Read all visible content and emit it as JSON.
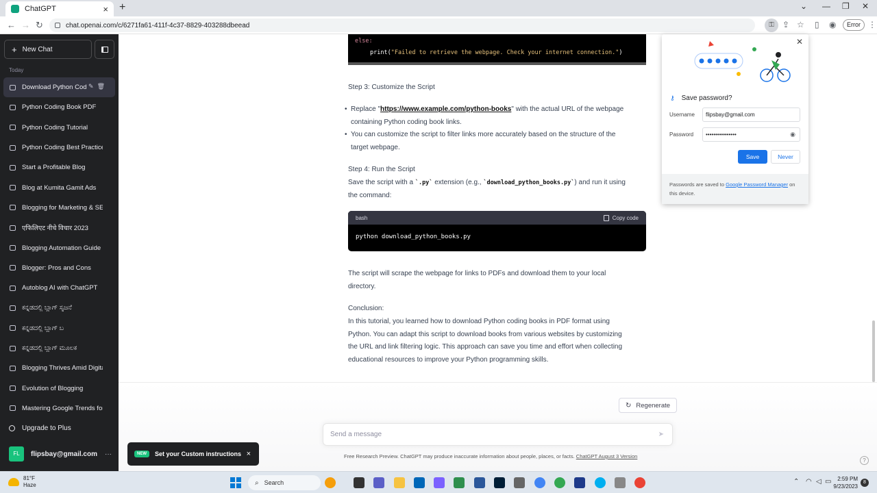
{
  "browser": {
    "tab_title": "ChatGPT",
    "url": "chat.openai.com/c/6271fa61-411f-4c37-8829-403288dbeead",
    "error_label": "Error"
  },
  "sidebar": {
    "new_chat": "New Chat",
    "section_today": "Today",
    "items": [
      {
        "label": "Download Python Cod"
      },
      {
        "label": "Python Coding Book PDF"
      },
      {
        "label": "Python Coding Tutorial"
      },
      {
        "label": "Python Coding Best Practice"
      },
      {
        "label": "Start a Profitable Blog"
      },
      {
        "label": "Blog at Kumita Gamit Ads"
      },
      {
        "label": "Blogging for Marketing & SE"
      },
      {
        "label": "एफिलिएट नीचे विचार 2023"
      },
      {
        "label": "Blogging Automation Guide"
      },
      {
        "label": "Blogger: Pros and Cons"
      },
      {
        "label": "Autoblog AI with ChatGPT"
      },
      {
        "label": "ಕನ್ನಡದಲ್ಲಿ ಬ್ಲಾಗ್ ಸೃಜನೆ"
      },
      {
        "label": "ಕನ್ನಡದಲ್ಲಿ ಬ್ಲಾಗ್ ಬ"
      },
      {
        "label": "ಕನ್ನಡದಲ್ಲಿ ಬ್ಲಾಗ್ ಮೂಲಕ"
      },
      {
        "label": "Blogging Thrives Amid Digita"
      },
      {
        "label": "Evolution of Blogging"
      },
      {
        "label": "Mastering Google Trends for"
      }
    ],
    "upgrade": "Upgrade to Plus",
    "avatar_initials": "FL",
    "account_email": "flipsbay@gmail.com"
  },
  "content": {
    "code1_kw": "else:",
    "code1_fn": "print(",
    "code1_str": "\"Failed to retrieve the webpage. Check your internet connection.\"",
    "code1_end": ")",
    "step3_title": "Step 3: Customize the Script",
    "bullet1_pre": "Replace \"",
    "bullet1_link": "https://www.example.com/python-books",
    "bullet1_post": "\" with the actual URL of the webpage",
    "bullet1_line2": "containing Python coding book links.",
    "bullet2_line1": "You can customize the script to filter links more accurately based on the structure of the",
    "bullet2_line2": "target webpage.",
    "step4_title": "Step 4: Run the Script",
    "step4_pre": "Save the script with a ",
    "step4_ext": "`.py`",
    "step4_mid": " extension (e.g., ",
    "step4_file": "`download_python_books.py`",
    "step4_post": ") and run it using",
    "step4_line2": "the command:",
    "code2_lang": "bash",
    "code2_copy": "Copy code",
    "code2_cmd": "python download_python_books.py",
    "scrape_line1": "The script will scrape the webpage for links to PDFs and download them to your local",
    "scrape_line2": "directory.",
    "conclusion_title": "Conclusion:",
    "conclusion_lines": [
      "In this tutorial, you learned how to download Python coding books in PDF format using",
      "Python. You can adapt this script to download books from various websites by customizing",
      "the URL and link filtering logic. This approach can save you time and effort when collecting",
      "educational resources to improve your Python programming skills."
    ]
  },
  "bottom": {
    "regenerate": "Regenerate",
    "message_placeholder": "Send a message",
    "footer_text": "Free Research Preview. ChatGPT may produce inaccurate information about people, places, or facts. ",
    "footer_link": "ChatGPT August 3 Version",
    "help": "?"
  },
  "toast": {
    "badge": "NEW",
    "text": "Set your Custom instructions"
  },
  "password_popup": {
    "title": "Save password?",
    "username_label": "Username",
    "username_value": "flipsbay@gmail.com",
    "password_label": "Password",
    "password_value": "••••••••••••••••",
    "save": "Save",
    "never": "Never",
    "note_pre": "Passwords are saved to ",
    "note_link": "Google Password Manager",
    "note_post": " on this device."
  },
  "taskbar": {
    "temperature": "81°F",
    "weather": "Haze",
    "search": "Search",
    "time": "2:59 PM",
    "date": "9/23/2023",
    "notifications": "8"
  },
  "colors": {
    "sidebar_bg": "#202123",
    "accent_green": "#19c37d",
    "google_blue": "#1a73e8"
  }
}
